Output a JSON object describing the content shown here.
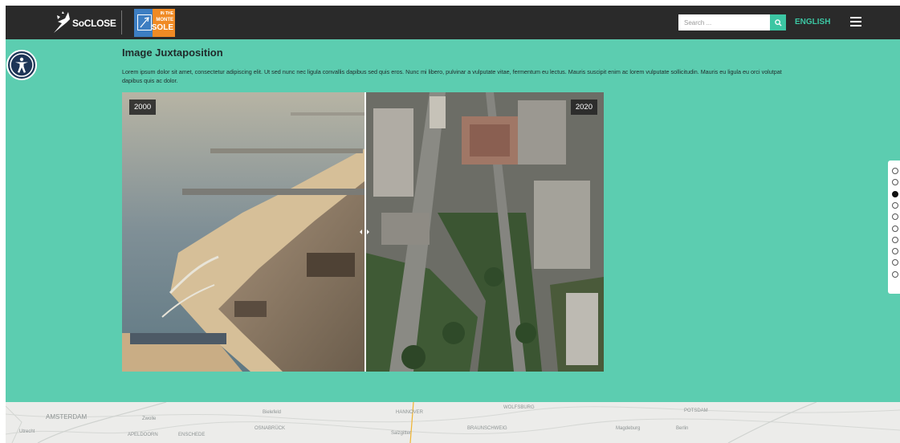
{
  "header": {
    "logo_text": "SoCLOSE",
    "partner_logo_lines": [
      "IN THE",
      "MONTE",
      "SOLE"
    ],
    "search_placeholder": "Search ...",
    "language": "ENGLISH"
  },
  "main": {
    "title": "Image Juxtaposition",
    "description": "Lorem ipsum dolor sit amet, consectetur adipiscing elit. Ut sed nunc nec ligula convallis dapibus sed quis eros. Nunc mi libero, pulvinar a vulputate vitae, fermentum eu lectus. Mauris suscipit enim ac lorem vulputate sollicitudin. Mauris eu ligula eu orci volutpat dapibus quis ac dolor.",
    "juxtaposition": {
      "before_label": "2000",
      "after_label": "2020",
      "slider_position_percent": 50.5
    }
  },
  "side_nav": {
    "count": 10,
    "active_index": 2
  },
  "map": {
    "labels": [
      {
        "text": "AMSTERDAM",
        "size": "big"
      },
      {
        "text": "APELDOORN",
        "size": "small"
      },
      {
        "text": "ENSCHEDE",
        "size": "small"
      },
      {
        "text": "OSNABRÜCK",
        "size": "small"
      },
      {
        "text": "HANNOVER",
        "size": "small"
      },
      {
        "text": "WOLFSBURG",
        "size": "small"
      },
      {
        "text": "BRAUNSCHWEIG",
        "size": "small"
      },
      {
        "text": "POTSDAM",
        "size": "small"
      },
      {
        "text": "Utrecht",
        "size": "small"
      },
      {
        "text": "Zwolle",
        "size": "small"
      },
      {
        "text": "Bielefeld",
        "size": "small"
      },
      {
        "text": "Magdeburg",
        "size": "small"
      },
      {
        "text": "Berlin",
        "size": "small"
      },
      {
        "text": "Salzgitter",
        "size": "small"
      }
    ]
  },
  "colors": {
    "header_bg": "#2a2a2a",
    "accent": "#3cc6a3",
    "main_bg": "#5ccdb0",
    "a11y_button_bg": "#1d3557"
  },
  "icons": {
    "search_button": "search-icon",
    "menu": "hamburger-menu-icon",
    "accessibility": "accessibility-icon",
    "slider_handle": "chevron-left-right-icon"
  }
}
